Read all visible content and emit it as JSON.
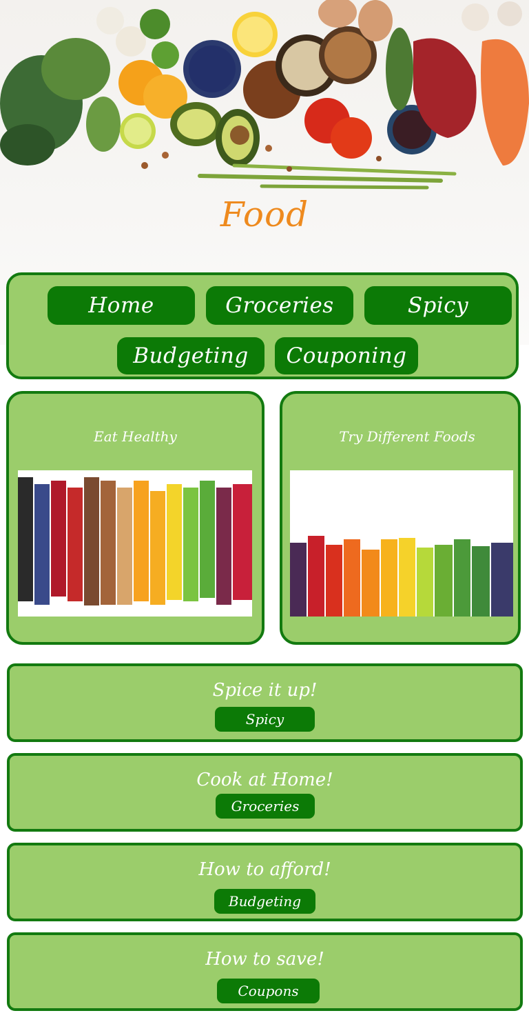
{
  "hero": {
    "title": "Food"
  },
  "nav": {
    "items": [
      {
        "label": "Home"
      },
      {
        "label": "Groceries"
      },
      {
        "label": "Spicy"
      },
      {
        "label": "Budgeting"
      },
      {
        "label": "Couponing"
      }
    ]
  },
  "cards": [
    {
      "title": "Eat Healthy"
    },
    {
      "title": "Try Different Foods"
    }
  ],
  "ctas": [
    {
      "heading": "Spice it up!",
      "button": "Spicy"
    },
    {
      "heading": "Cook at Home!",
      "button": "Groceries"
    },
    {
      "heading": "How to afford!",
      "button": "Budgeting"
    },
    {
      "heading": "How to save!",
      "button": "Coupons"
    }
  ],
  "colors": {
    "panel_bg": "#9bcd6b",
    "panel_border": "#137a10",
    "button_bg": "#0c7a06",
    "button_text": "#ffffff",
    "hero_title": "#ee8a1e"
  }
}
